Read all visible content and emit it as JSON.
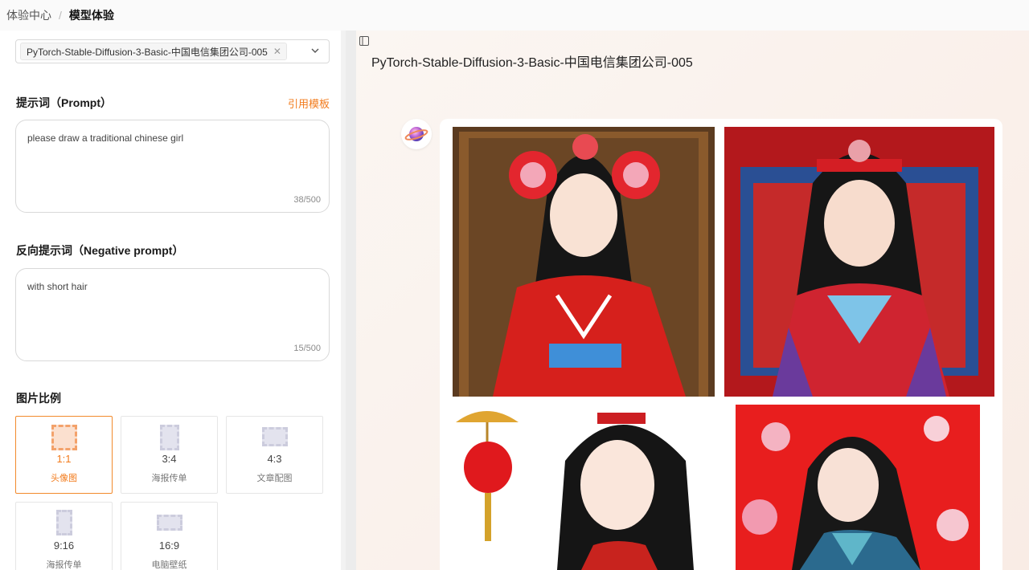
{
  "breadcrumb": {
    "parent": "体验中心",
    "separator": "/",
    "current": "模型体验"
  },
  "model_select": {
    "selected": "PyTorch-Stable-Diffusion-3-Basic-中国电信集团公司-005"
  },
  "prompt": {
    "label": "提示词（Prompt）",
    "template_link": "引用模板",
    "value": "please draw a traditional chinese girl",
    "count": "38/500"
  },
  "negative_prompt": {
    "label": "反向提示词（Negative prompt）",
    "value": "with short hair",
    "count": "15/500"
  },
  "ratio": {
    "label": "图片比例",
    "options": [
      {
        "ratio": "1:1",
        "name": "头像图",
        "selected": true
      },
      {
        "ratio": "3:4",
        "name": "海报传单",
        "selected": false
      },
      {
        "ratio": "4:3",
        "name": "文章配图",
        "selected": false
      },
      {
        "ratio": "9:16",
        "name": "海报传单",
        "selected": false
      },
      {
        "ratio": "16:9",
        "name": "电脑壁纸",
        "selected": false
      }
    ]
  },
  "result": {
    "model_title": "PyTorch-Stable-Diffusion-3-Basic-中国电信集团公司-005",
    "images": [
      "generated-image-1",
      "generated-image-2",
      "generated-image-3",
      "generated-image-4"
    ]
  },
  "colors": {
    "accent": "#f27b1c",
    "border": "#d9d9d9"
  }
}
